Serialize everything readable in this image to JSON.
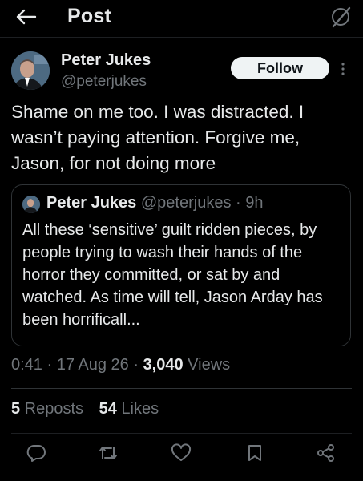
{
  "header": {
    "title": "Post",
    "back_icon": "arrow-left-icon",
    "grok_icon": "grok-icon"
  },
  "post": {
    "author_name": "Peter Jukes",
    "author_handle": "@peterjukes",
    "follow_label": "Follow",
    "text": "Shame on me too. I was distracted. I wasn’t paying attention. Forgive me, Jason, for not doing more",
    "quote": {
      "author_name": "Peter Jukes",
      "meta": "@peterjukes · 9h",
      "text": "All these ‘sensitive’ guilt ridden pieces, by people trying to wash their hands of the horror they committed, or sat by and watched. As time will tell, Jason Arday has been horrificall..."
    },
    "time": "0:41 · 17 Aug 26 · ",
    "views_count": "3,040",
    "views_label": " Views"
  },
  "stats": {
    "reposts_count": "5",
    "reposts_label": " Reposts",
    "likes_count": "54",
    "likes_label": " Likes"
  },
  "actions": [
    "reply-icon",
    "repost-icon",
    "like-icon",
    "bookmark-icon",
    "share-icon"
  ],
  "colors": {
    "background": "#000000",
    "text": "#e7e9ea",
    "secondary": "#71767b",
    "border": "#2f3336",
    "follow_bg": "#eff3f4"
  }
}
